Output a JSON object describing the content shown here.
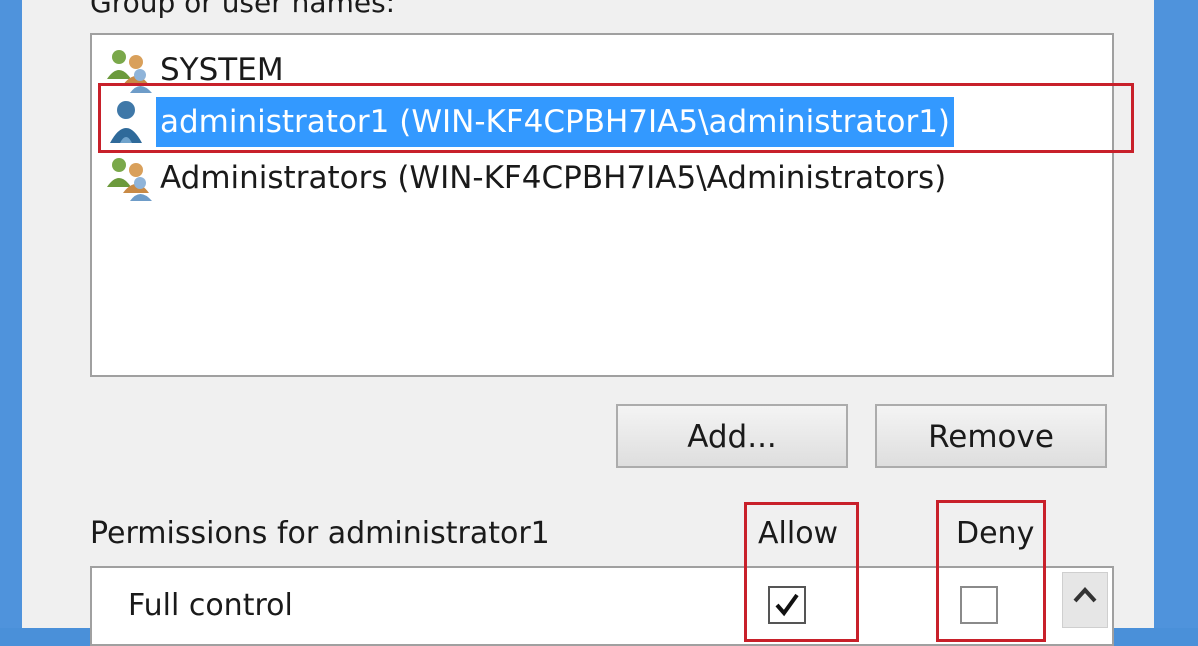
{
  "group_label": "Group or user names:",
  "users": [
    {
      "name": "SYSTEM",
      "icon": "group-users-icon",
      "selected": false
    },
    {
      "name": "administrator1 (WIN-KF4CPBH7IA5\\administrator1)",
      "icon": "user-icon",
      "selected": true
    },
    {
      "name": "Administrators (WIN-KF4CPBH7IA5\\Administrators)",
      "icon": "group-users-icon",
      "selected": false
    }
  ],
  "buttons": {
    "add": "Add...",
    "remove": "Remove"
  },
  "permissions": {
    "label": "Permissions for administrator1",
    "allow_header": "Allow",
    "deny_header": "Deny",
    "rows": [
      {
        "name": "Full control",
        "allow": true,
        "deny": false
      }
    ]
  },
  "colors": {
    "selection": "#3399ff",
    "highlight_box": "#c8202a"
  }
}
